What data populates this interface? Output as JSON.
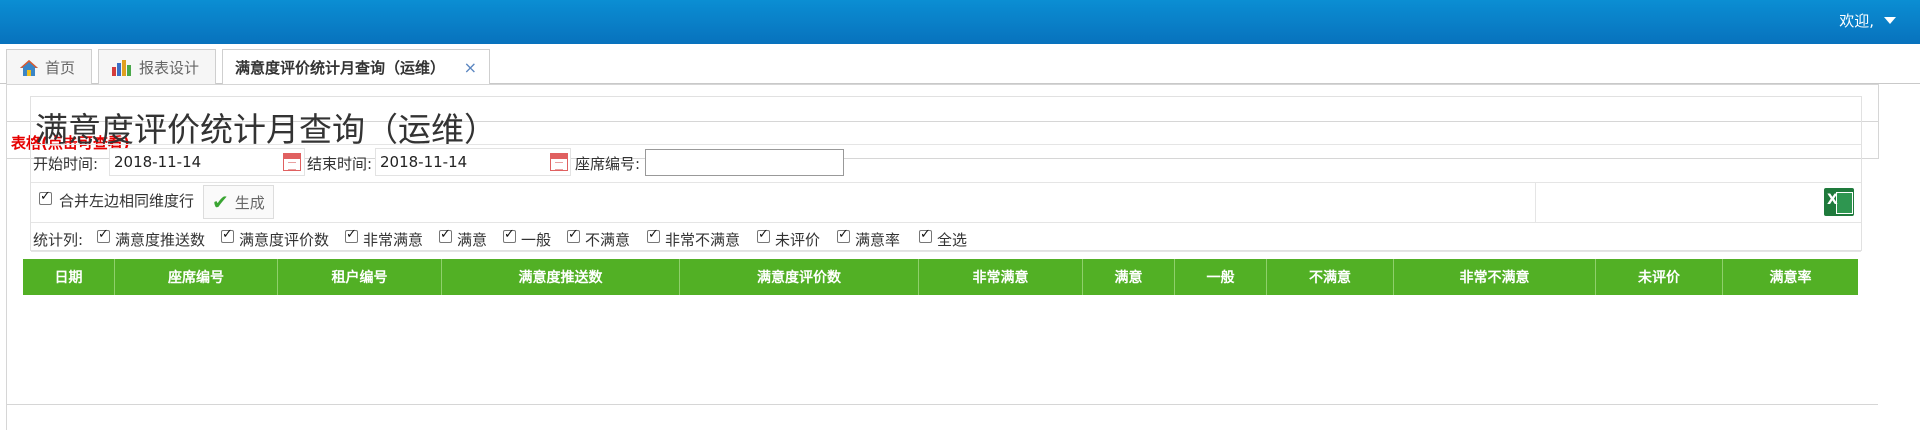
{
  "header": {
    "welcome": "欢迎,"
  },
  "tabs": [
    {
      "label": "首页",
      "icon": "home-icon"
    },
    {
      "label": "报表设计",
      "icon": "bar-chart-icon"
    },
    {
      "label": "满意度评价统计月查询（运维）",
      "icon": null,
      "close": "×"
    }
  ],
  "content": {
    "table_link_label": "表格(点击可查看)"
  },
  "report": {
    "title": "满意度评价统计月查询（运维）",
    "start_time_label": "开始时间:",
    "start_time_value": "2018-11-14",
    "end_time_label": "结束时间:",
    "end_time_value": "2018-11-14",
    "seat_label": "座席编号:",
    "seat_value": "",
    "merge_label": "合并左边相同维度行",
    "generate_label": "生成",
    "export_icon": "excel-icon",
    "stat_columns_label": "统计列:",
    "stat_columns": [
      "满意度推送数",
      "满意度评价数",
      "非常满意",
      "满意",
      "一般",
      "不满意",
      "非常不满意",
      "未评价",
      "满意率",
      "全选"
    ]
  },
  "grid": {
    "columns": [
      "日期",
      "座席编号",
      "租户编号",
      "满意度推送数",
      "满意度评价数",
      "非常满意",
      "满意",
      "一般",
      "不满意",
      "非常不满意",
      "未评价",
      "满意率"
    ],
    "header_color": "#52b025"
  },
  "colors": {
    "topbar": "#0872bd",
    "accent_red": "#e60000",
    "header_green": "#52b025"
  }
}
